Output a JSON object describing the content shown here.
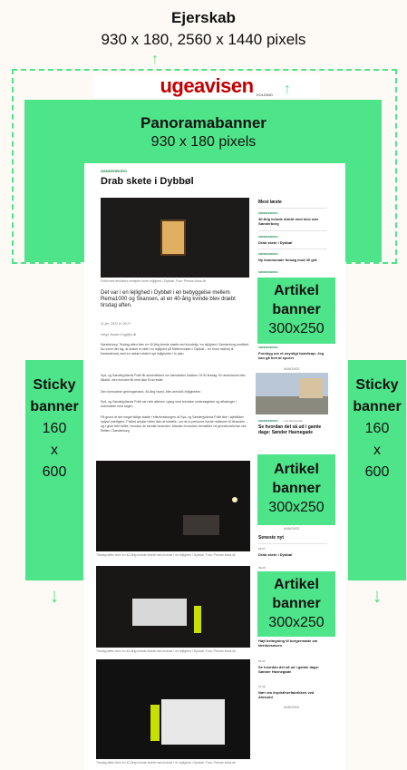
{
  "ejerskab": {
    "title": "Ejerskab",
    "size": "930 x 180, 2560 x 1440 pixels"
  },
  "logo": {
    "text": "ugeavisen",
    "sub": "KOLDING"
  },
  "panorama": {
    "title": "Panoramabanner",
    "size": "930 x 180 pixels"
  },
  "article": {
    "category": "SØNDERBORG",
    "title": "Drab skete i Dybbøl",
    "caption1": "Politi med teknikere arbejder foran lejlighed i Dybbøl. Foto: Presse-fotos.dk",
    "lead": "Det var i en lejlighed i Dybbøl i en bebyggelse mellem Rema1000 og Skansen, at en 40-årig kvinde blev dræbt tirsdag aften.",
    "date": "11 jan. 2022 kl. 09:27",
    "author": "Helge Jepsen hvjg@jv.dk",
    "p1": "Sønderborg: Tirsdag aften blev en 40-årig kvinde dræbt ved kvindelig i en lejlighed i Sønderborg-området. Nu vover det sig, at drabet er sket i en lejlighed på Mellemvolden i Dybbøl – en bund midtvej til Kastanienvej med en række relativt nye lejligheder i to plan.",
    "p2": "Syd- og Sønderjyllands Politi fik anmeldelsen om hændelsen klokken 19:34 tirsdag. En ambulance blev tilkaldt, men kvinden fik med ikke til at redde.",
    "p3": "Den formodede gerningsmand, 40-årig mand, blev anholdt i lejligheden.",
    "p4": "Syd- og Sønderjyllands Politi var hele aftenen i gang med tekniske undersøgelser og afhøringer i forbindelse med sagen.",
    "p5": "På grund af det meget tidlige stadie i efterforskningen vil Syd- og Sønderjyllands Politi ikke i øjeblikket oplyse yderligere. Politiet ønsker heller ikke at fortælle, om de to personer havde relationer til hinanden – og i givet fald hvilke, hvordan de kendte hinanden. Manden forventes fremstillet i et grundlovsforhør ved Retten i Sønderborg.",
    "caption2": "Tirsdag aften blev en 40-årig kvinde dræbt med kvinde i en lejlighed i Dybbøl. Foto: Presse-fotos.dk",
    "caption3": "Tirsdag aften blev en 40-årig kvinde dræbt med kvinde i en lejlighed i Dybbøl. Foto: Presse-fotos.dk",
    "caption4": "Tirsdag aften blev en 40-årig kvinde dræbt med kvinde i en lejlighed i Dybbøl. Foto: Presse-fotos.dk"
  },
  "sidebar": {
    "most_read": "Mest læste",
    "items": [
      {
        "cat": "SØNDERBORG",
        "text": "40-årig kvinde dræbt med kniv nær Sønderborg"
      },
      {
        "cat": "SØNDERBORG",
        "text": "Drab skete i Dybbøl"
      },
      {
        "cat": "SØNDERBORG",
        "text": "Ny kommunale forsøg mod 40 grå"
      },
      {
        "cat": "SØNDERBORG",
        "text": ""
      }
    ],
    "item_after1_cat": "SØNDERBORG",
    "item_after1": "Forebyg om et usynligt handicap: Jeg kan gå helt af sporet",
    "annonce": "ANNONCE",
    "feature_cat": "SØNDERBORG",
    "feature_tag": "+ for abonnenter",
    "feature_title": "Se hvordan det så ud i gamle dage: Sønder Havnegade",
    "seneste": "Seneste nyt",
    "seneste_items": [
      {
        "time": "09.27",
        "text": "Drab skete i Dybbøl"
      },
      {
        "time": "09.26",
        "text": ""
      },
      {
        "time": "",
        "text": "Højt belægning til borgermøde om færdsvsæsen"
      },
      {
        "time": "15.31",
        "text": "Se hvordan det så ud i gamle dage: Sønder Havnegade"
      },
      {
        "time": "14.49",
        "text": "Nær om krydsfinerfabrikken ved Alssund"
      }
    ]
  },
  "boxes": {
    "artikel": "Artikel",
    "banner": "banner",
    "size": "300x250"
  },
  "sticky": {
    "line1": "Sticky",
    "line2": "banner",
    "line3": "160",
    "line4": "x",
    "line5": "600"
  },
  "colors": {
    "accent": "#4ee489",
    "logo_red": "#c40000"
  }
}
